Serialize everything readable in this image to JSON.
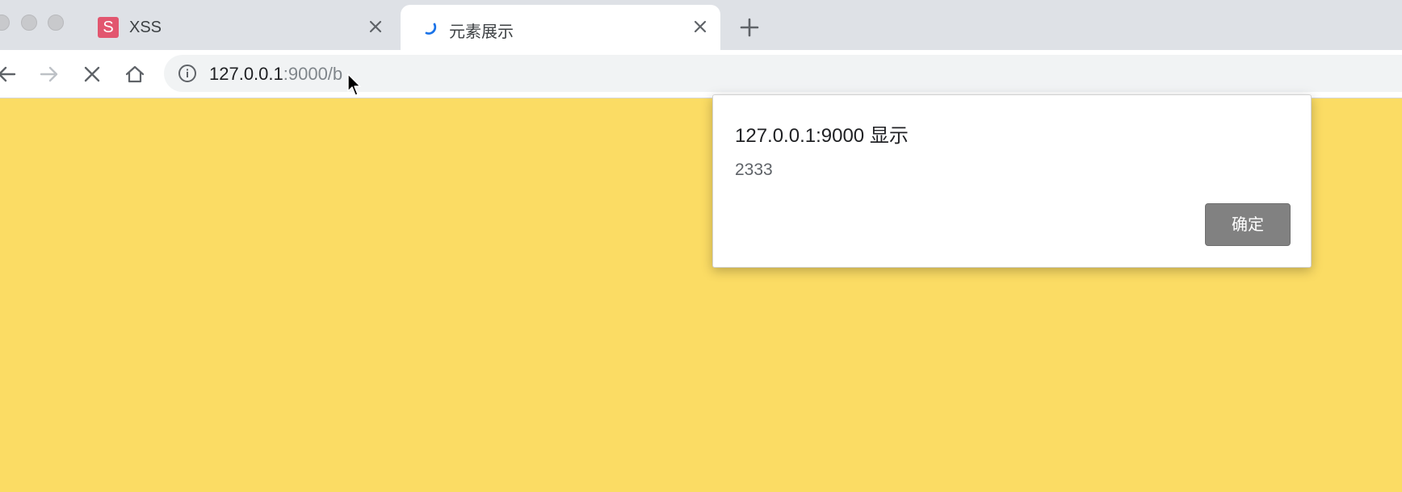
{
  "tabs": [
    {
      "favicon_letter": "S",
      "title": "XSS",
      "active": false
    },
    {
      "title": "元素展示",
      "active": true,
      "loading": true
    }
  ],
  "toolbar": {
    "url_host": "127.0.0.1",
    "url_rest": ":9000/b"
  },
  "dialog": {
    "title": "127.0.0.1:9000 显示",
    "message": "2333",
    "ok_label": "确定"
  },
  "colors": {
    "page_background": "#fbdc64",
    "tab_strip": "#dee1e6",
    "favicon_s": "#e2566f",
    "spinner": "#1a73e8",
    "ok_button": "#818181"
  },
  "icons": {
    "back": "arrow-left-icon",
    "forward": "arrow-right-icon",
    "stop": "close-icon",
    "home": "home-icon",
    "site_info": "info-icon",
    "new_tab": "plus-icon",
    "pointer": "mouse-cursor-icon"
  }
}
